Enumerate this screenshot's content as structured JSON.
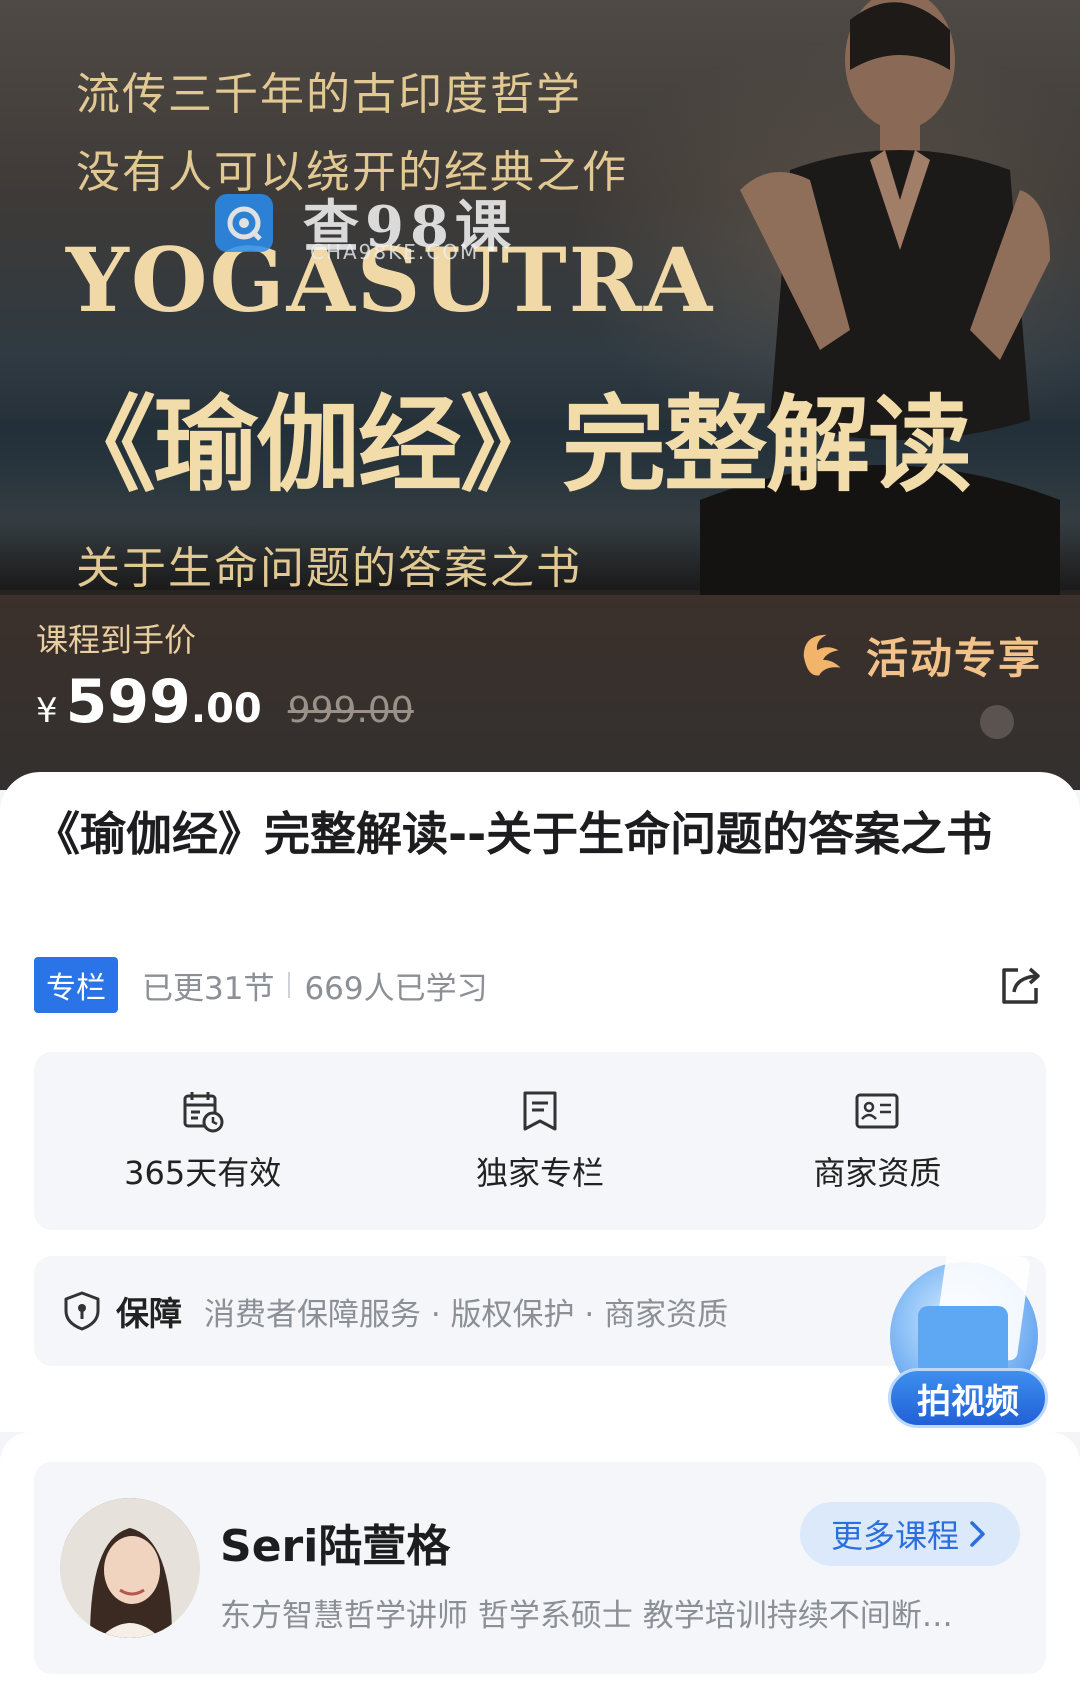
{
  "hero": {
    "line1": "流传三千年的古印度哲学",
    "line2": "没有人可以绕开的经典之作",
    "english_title": "YOGASUTRA",
    "main_title": "《瑜伽经》完整解读",
    "subtitle": "关于生命问题的答案之书",
    "watermark_text": "查98课",
    "watermark_domain": "CHA98KE.COM"
  },
  "price": {
    "label": "课程到手价",
    "currency": "¥",
    "current_int": "599",
    "current_dec": ".00",
    "original": "999.00",
    "promo_label": "活动专享"
  },
  "course": {
    "title": "《瑜伽经》完整解读--关于生命问题的答案之书",
    "tag": "专栏",
    "updated": "已更31节",
    "learners": "669人已学习"
  },
  "features": [
    {
      "label": "365天有效",
      "icon": "calendar-clock-icon"
    },
    {
      "label": "独家专栏",
      "icon": "bookmark-doc-icon"
    },
    {
      "label": "商家资质",
      "icon": "id-card-icon"
    }
  ],
  "guarantee": {
    "title": "保障",
    "items": "消费者保障服务 · 版权保护 · 商家资质"
  },
  "video_button": {
    "label": "拍视频"
  },
  "teacher": {
    "name": "Seri陆萱格",
    "more_label": "更多课程",
    "description": "东方智慧哲学讲师 哲学系硕士 教学培训持续不间断…"
  },
  "colors": {
    "accent_blue": "#2a74e8",
    "gold": "#e8cf9a",
    "promo_orange": "#f2c28a"
  }
}
